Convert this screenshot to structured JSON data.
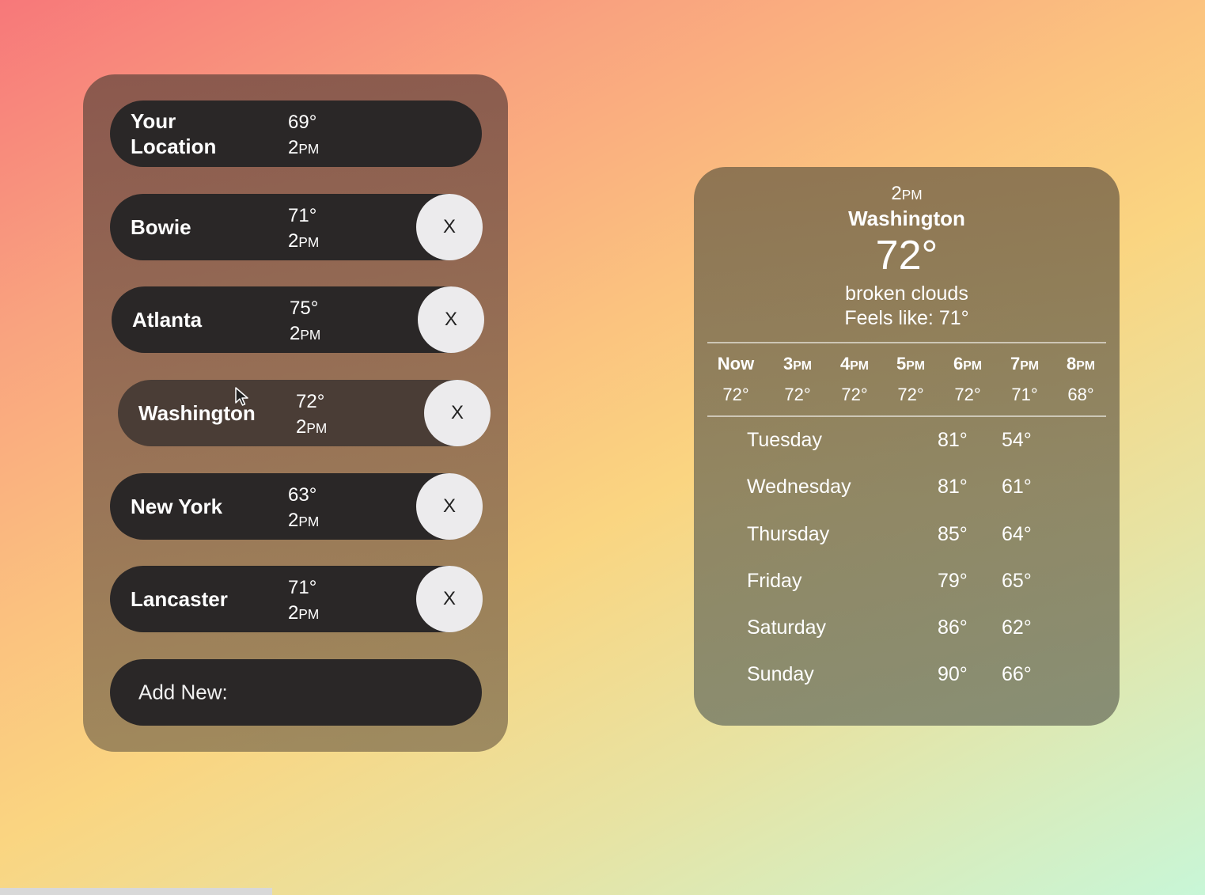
{
  "locations": [
    {
      "city": "Your Location",
      "temp": "69°",
      "hour": "2",
      "ampm": "PM",
      "removable": false
    },
    {
      "city": "Bowie",
      "temp": "71°",
      "hour": "2",
      "ampm": "PM",
      "removable": true,
      "remove_label": "X"
    },
    {
      "city": "Atlanta",
      "temp": "75°",
      "hour": "2",
      "ampm": "PM",
      "removable": true,
      "remove_label": "X"
    },
    {
      "city": "Washington",
      "temp": "72°",
      "hour": "2",
      "ampm": "PM",
      "removable": true,
      "remove_label": "X"
    },
    {
      "city": "New York",
      "temp": "63°",
      "hour": "2",
      "ampm": "PM",
      "removable": true,
      "remove_label": "X"
    },
    {
      "city": "Lancaster",
      "temp": "71°",
      "hour": "2",
      "ampm": "PM",
      "removable": true,
      "remove_label": "X"
    }
  ],
  "add_new": {
    "label": "Add New:"
  },
  "detail": {
    "time_hour": "2",
    "time_ampm": "PM",
    "city": "Washington",
    "temp": "72°",
    "description": "broken clouds",
    "feels_like": "Feels like: 71°",
    "hourly": [
      {
        "hour": "Now",
        "ampm": "",
        "temp": "72°"
      },
      {
        "hour": "3",
        "ampm": "PM",
        "temp": "72°"
      },
      {
        "hour": "4",
        "ampm": "PM",
        "temp": "72°"
      },
      {
        "hour": "5",
        "ampm": "PM",
        "temp": "72°"
      },
      {
        "hour": "6",
        "ampm": "PM",
        "temp": "72°"
      },
      {
        "hour": "7",
        "ampm": "PM",
        "temp": "71°"
      },
      {
        "hour": "8",
        "ampm": "PM",
        "temp": "68°"
      }
    ],
    "daily": [
      {
        "day": "Tuesday",
        "high": "81°",
        "low": "54°"
      },
      {
        "day": "Wednesday",
        "high": "81°",
        "low": "61°"
      },
      {
        "day": "Thursday",
        "high": "85°",
        "low": "64°"
      },
      {
        "day": "Friday",
        "high": "79°",
        "low": "65°"
      },
      {
        "day": "Saturday",
        "high": "86°",
        "low": "62°"
      },
      {
        "day": "Sunday",
        "high": "90°",
        "low": "66°"
      }
    ]
  },
  "colors": {
    "pill": "#2a2727",
    "pill_active": "#4a3d36",
    "remove_button": "#ecebed"
  },
  "icons": {
    "cursor": "mouse-pointer-icon"
  }
}
